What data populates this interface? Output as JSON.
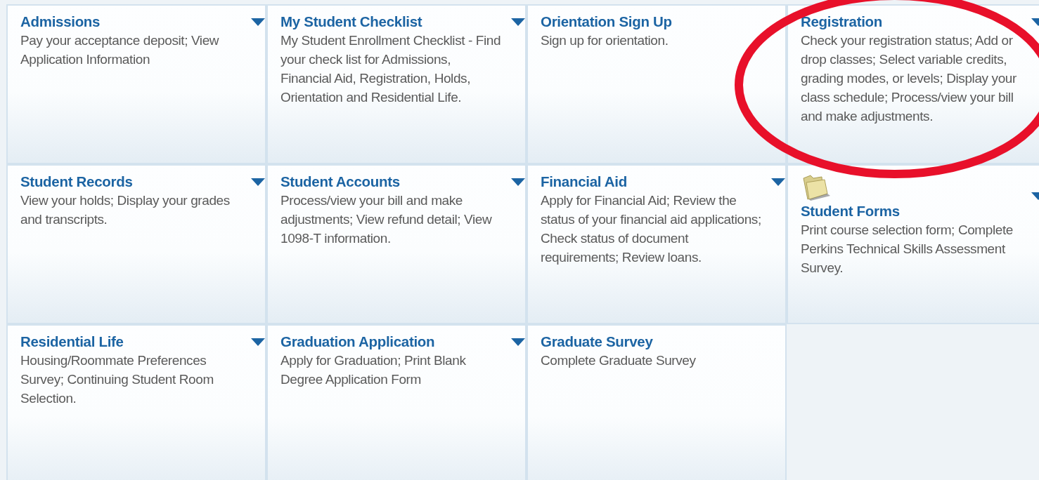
{
  "tiles": [
    {
      "title": "Admissions",
      "description": "Pay your acceptance deposit; View Application Information",
      "has_menu": true,
      "kind": "plain",
      "circled": false
    },
    {
      "title": "My Student Checklist",
      "description": "My Student Enrollment Checklist - Find your check list for Admissions, Financial Aid, Registration, Holds, Orientation and Residential Life.",
      "has_menu": true,
      "kind": "plain",
      "circled": false
    },
    {
      "title": "Orientation Sign Up",
      "description": "Sign up for orientation.",
      "has_menu": false,
      "kind": "plain",
      "circled": false
    },
    {
      "title": "Registration",
      "description": "Check your registration status; Add or drop classes; Select variable credits, grading modes, or levels; Display your class schedule; Process/view your bill and make adjustments.",
      "has_menu": true,
      "kind": "plain",
      "circled": true
    },
    {
      "title": "Student Records",
      "description": "View your holds; Display your grades and transcripts.",
      "has_menu": true,
      "kind": "plain",
      "circled": false
    },
    {
      "title": "Student Accounts",
      "description": "Process/view your bill and make adjustments; View refund detail; View 1098-T information.",
      "has_menu": true,
      "kind": "plain",
      "circled": false
    },
    {
      "title": "Financial Aid",
      "description": "Apply for Financial Aid; Review the status of your financial aid applications; Check status of document requirements; Review loans.",
      "has_menu": true,
      "kind": "plain",
      "circled": false
    },
    {
      "title": "Student Forms",
      "description": "Print course selection form; Complete Perkins Technical Skills Assessment Survey.",
      "has_menu": true,
      "kind": "folder",
      "circled": false
    },
    {
      "title": "Residential Life",
      "description": "Housing/Roommate Preferences Survey; Continuing Student Room Selection.",
      "has_menu": true,
      "kind": "plain",
      "circled": false
    },
    {
      "title": "Graduation Application",
      "description": "Apply for Graduation; Print Blank Degree Application Form",
      "has_menu": true,
      "kind": "plain",
      "circled": false
    },
    {
      "title": "Graduate Survey",
      "description": "Complete Graduate Survey",
      "has_menu": false,
      "kind": "plain",
      "circled": false
    }
  ]
}
